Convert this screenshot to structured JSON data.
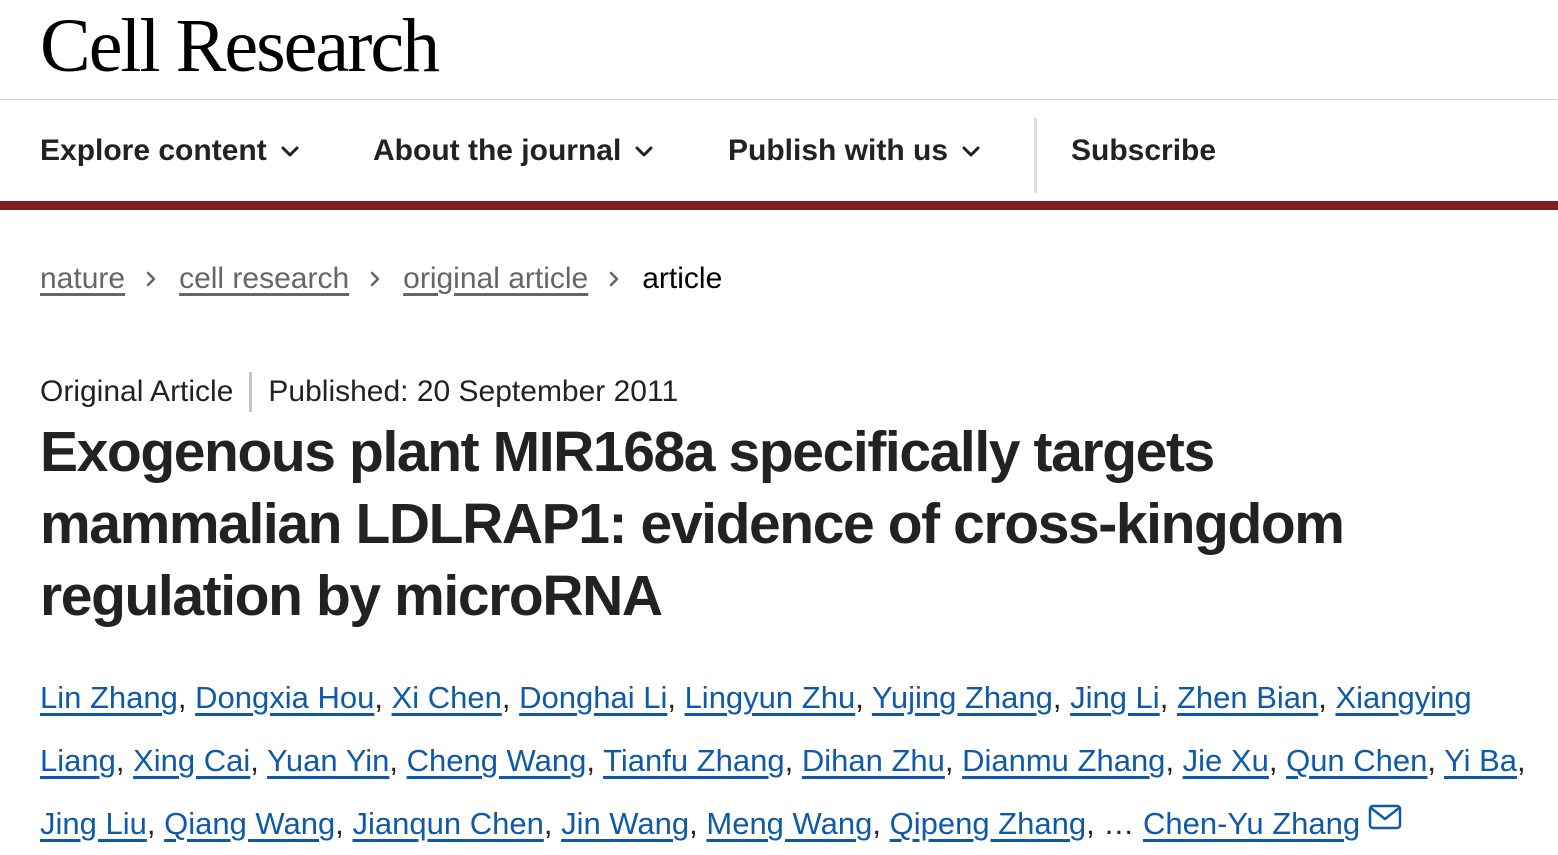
{
  "journal": {
    "name": "Cell Research"
  },
  "nav": {
    "explore": "Explore content",
    "about": "About the journal",
    "publish": "Publish with us",
    "subscribe": "Subscribe"
  },
  "breadcrumb": {
    "items": [
      "nature",
      "cell research",
      "original article"
    ],
    "current": "article"
  },
  "article": {
    "type": "Original Article",
    "published": "Published: 20 September 2011",
    "title": "Exogenous plant MIR168a specifically targets mammalian LDLRAP1: evidence of cross-kingdom regulation by microRNA",
    "authors": [
      "Lin Zhang",
      "Dongxia Hou",
      "Xi Chen",
      "Donghai Li",
      "Lingyun Zhu",
      "Yujing Zhang",
      "Jing Li",
      "Zhen Bian",
      "Xiangying Liang",
      "Xing Cai",
      "Yuan Yin",
      "Cheng Wang",
      "Tianfu Zhang",
      "Dihan Zhu",
      "Dianmu Zhang",
      "Jie Xu",
      "Qun Chen",
      "Yi Ba",
      "Jing Liu",
      "Qiang Wang",
      "Jianqun Chen",
      "Jin Wang",
      "Meng Wang",
      "Qipeng Zhang"
    ],
    "ellipsis": "…",
    "last_author": "Chen-Yu Zhang"
  },
  "colors": {
    "link": "#0f5aa8",
    "brand_bar": "#7f1d23",
    "breadcrumb_link": "#666666"
  },
  "icons": {
    "nav_chevron": "chevron-down-icon",
    "breadcrumb_sep": "chevron-right-icon",
    "contact": "mail-icon"
  }
}
